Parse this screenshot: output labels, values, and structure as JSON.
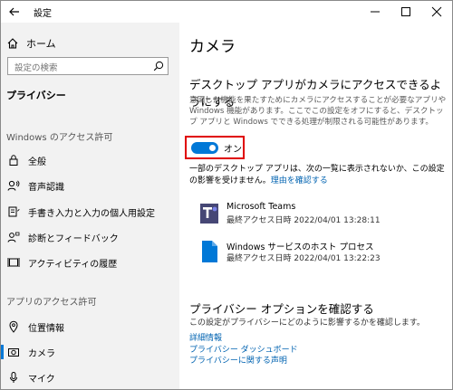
{
  "window": {
    "title": "設定"
  },
  "sidebar": {
    "home_label": "ホーム",
    "search_placeholder": "設定の検索",
    "section_title": "プライバシー",
    "group1_title": "Windows のアクセス許可",
    "group1_items": [
      {
        "label": "全般",
        "icon": "lock-icon"
      },
      {
        "label": "音声認識",
        "icon": "voice-icon"
      },
      {
        "label": "手書き入力と入力の個人用設定",
        "icon": "handwriting-icon"
      },
      {
        "label": "診断とフィードバック",
        "icon": "feedback-icon"
      },
      {
        "label": "アクティビティの履歴",
        "icon": "history-icon"
      }
    ],
    "group2_title": "アプリのアクセス許可",
    "group2_items": [
      {
        "label": "位置情報",
        "icon": "location-icon"
      },
      {
        "label": "カメラ",
        "icon": "camera-icon",
        "active": true
      },
      {
        "label": "マイク",
        "icon": "microphone-icon"
      }
    ]
  },
  "main": {
    "page_title": "カメラ",
    "section_title": "デスクトップ アプリがカメラにアクセスできるようにする",
    "section_desc": "意図した機能を果たすためにカメラにアクセスすることが必要なアプリや Windows 機能があります。ここでこの設定をオフにすると、デスクトップ アプリと Windows でできる処理が制限される可能性があります。",
    "toggle_state": "オン",
    "toggle_on": true,
    "note_text": "一部のデスクトップ アプリは、次の一覧に表示されないか、この設定の影響を受けません。",
    "note_link": "理由を確認する",
    "apps": [
      {
        "name": "Microsoft Teams",
        "last_access": "最終アクセス日時 2022/04/01 13:28:11",
        "icon": "teams-icon"
      },
      {
        "name": "Windows サービスのホスト プロセス",
        "last_access": "最終アクセス日時 2022/04/01 13:22:23",
        "icon": "file-icon"
      }
    ],
    "privacy_title": "プライバシー オプションを確認する",
    "privacy_desc": "この設定がプライバシーにどのように影響するかを確認します。",
    "privacy_links": [
      "詳細情報",
      "プライバシー ダッシュボード",
      "プライバシーに関する声明"
    ]
  }
}
